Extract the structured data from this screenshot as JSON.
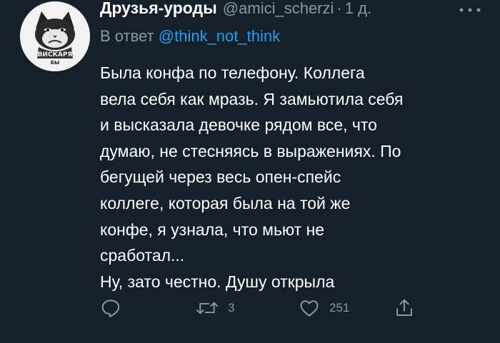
{
  "tweet": {
    "author": {
      "display_name": "Друзья-уроды",
      "handle": "@amici_scherzi",
      "avatar_icon": "grumpy-cat-avatar",
      "avatar_text_top": "ВИСКАРЯ",
      "avatar_text_bottom": "БЫ"
    },
    "separator": "·",
    "time": "1 д.",
    "more_icon": "more-dots-icon",
    "reply_prefix": "В ответ",
    "reply_mention": "@think_not_think",
    "text_lines": [
      "Была конфа по телефону. Коллега",
      "вела себя как мразь. Я замьютила себя",
      "и высказала девочке рядом все, что",
      "думаю, не стесняясь в выражениях. По",
      "бегущей через весь опен-спейс",
      "коллеге, которая была на той же",
      "конфе, я узнала, что мьют не",
      "сработал...",
      "Ну, зато честно. Душу открыла"
    ],
    "actions": {
      "reply": {
        "icon": "reply-icon"
      },
      "retweet": {
        "icon": "retweet-icon",
        "count": "3"
      },
      "like": {
        "icon": "heart-icon",
        "count": "251"
      },
      "share": {
        "icon": "share-icon"
      }
    },
    "colors": {
      "background": "#15202b",
      "primary_text": "#ffffff",
      "secondary_text": "#8899a6",
      "link": "#1da1f2"
    }
  }
}
